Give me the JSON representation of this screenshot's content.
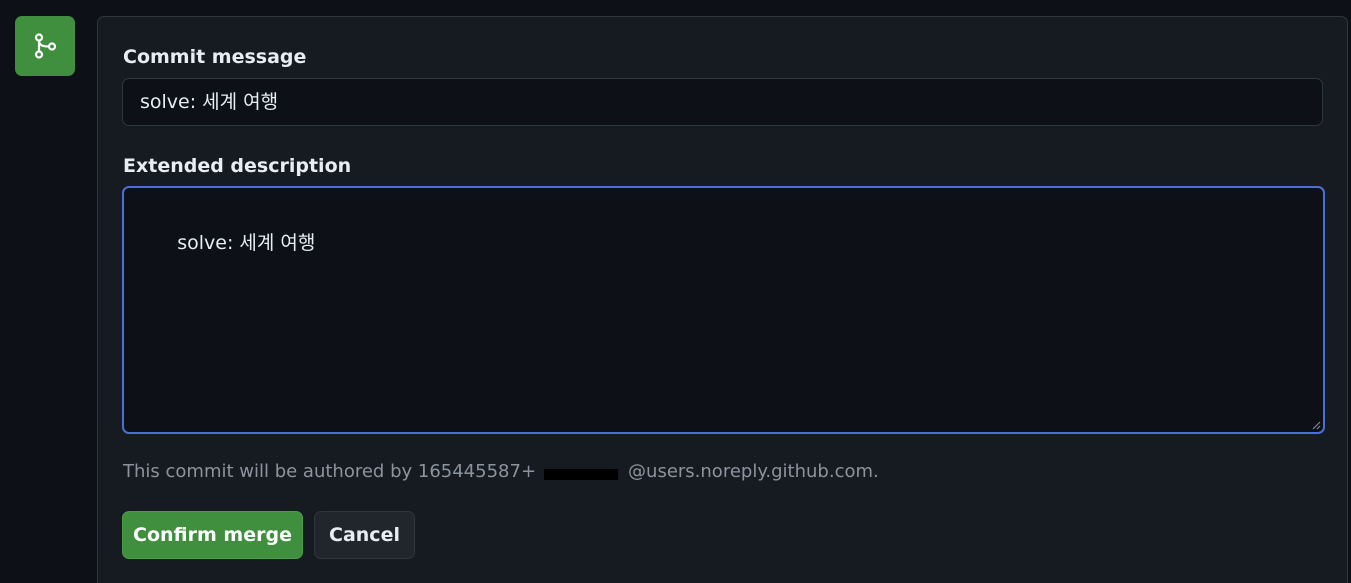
{
  "merge_icon": "git-merge-icon",
  "form": {
    "commit_label": "Commit message",
    "commit_value": "solve: 세계 여행",
    "description_label": "Extended description",
    "description_value": "solve: 세계 여행",
    "author_prefix": "This commit will be authored by 165445587+",
    "author_suffix": "@users.noreply.github.com."
  },
  "buttons": {
    "confirm_label": "Confirm merge",
    "cancel_label": "Cancel"
  },
  "colors": {
    "page_bg": "#0d1117",
    "panel_bg": "#161b22",
    "accent_green": "#3f8f3f",
    "focus_blue": "#4c6fd6"
  }
}
